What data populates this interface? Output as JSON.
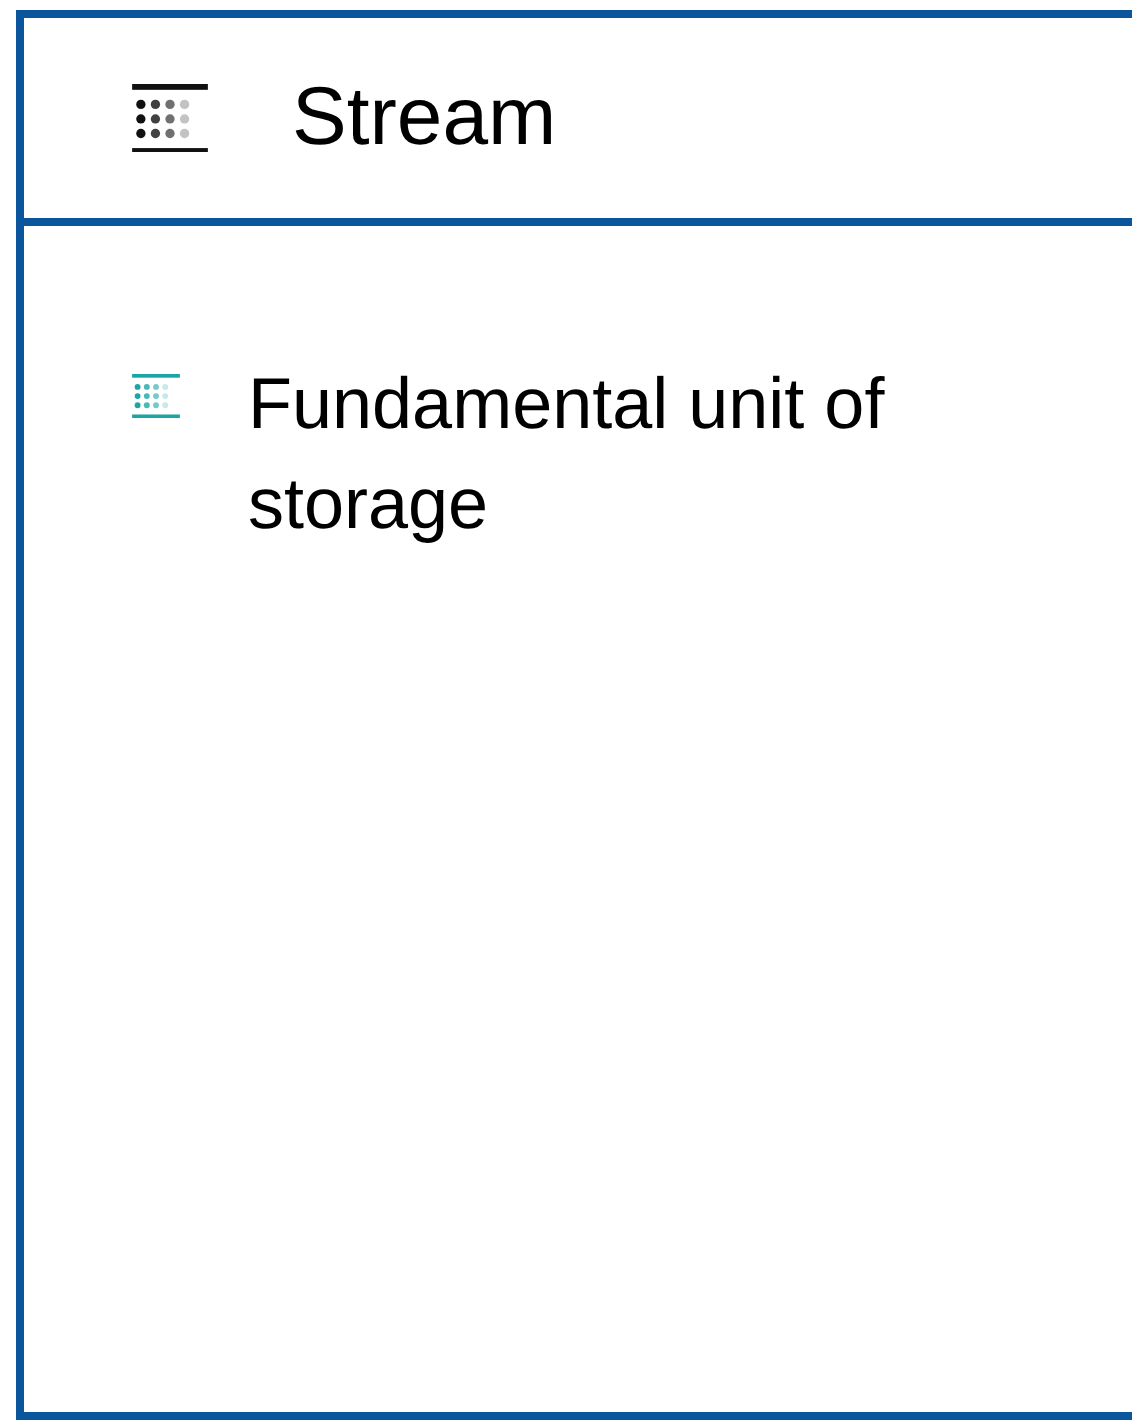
{
  "header": {
    "title": "Stream"
  },
  "items": [
    {
      "text": "Fundamental unit of storage"
    }
  ]
}
